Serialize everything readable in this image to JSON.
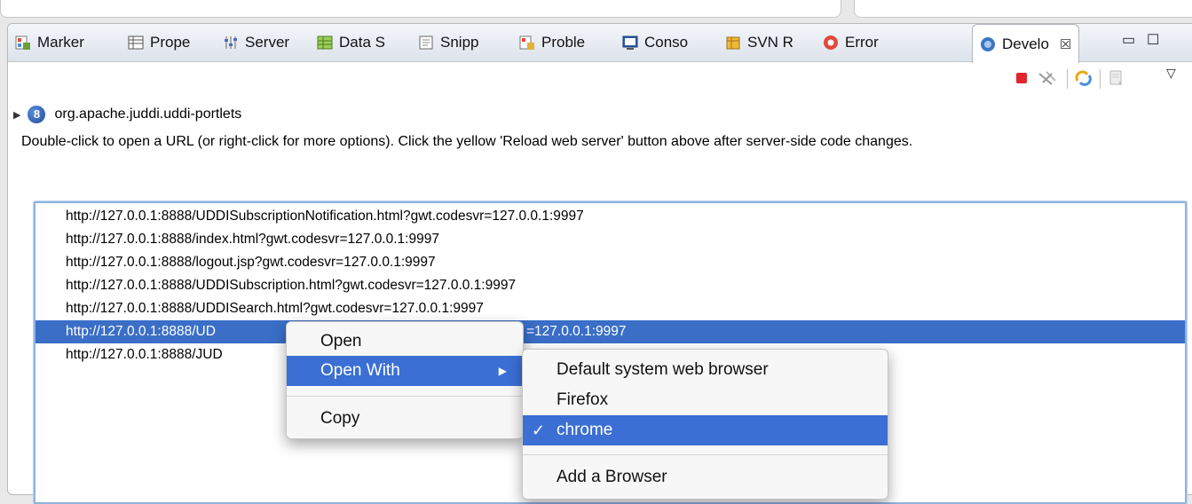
{
  "tabs": [
    {
      "label": "Marker",
      "icon": "marker-icon"
    },
    {
      "label": "Prope",
      "icon": "properties-icon"
    },
    {
      "label": "Server",
      "icon": "server-icon"
    },
    {
      "label": "Data S",
      "icon": "data-source-icon"
    },
    {
      "label": "Snipp",
      "icon": "snippets-icon"
    },
    {
      "label": "Proble",
      "icon": "problems-icon"
    },
    {
      "label": "Conso",
      "icon": "console-icon"
    },
    {
      "label": "SVN R",
      "icon": "svn-icon"
    },
    {
      "label": "Error",
      "icon": "error-icon"
    },
    {
      "label": "Develo",
      "icon": "gwt-icon",
      "close": "☒"
    }
  ],
  "window_buttons": {
    "minimize": "▭",
    "maximize": "☐",
    "view_menu": "▽"
  },
  "tree": {
    "project": "org.apache.juddi.uddi-portlets",
    "project_icon": "8"
  },
  "info_text": "Double-click to open a URL (or right-click for more options). Click the yellow 'Reload web server' button above after server-side code changes.",
  "urls": [
    "http://127.0.0.1:8888/UDDISubscriptionNotification.html?gwt.codesvr=127.0.0.1:9997",
    "http://127.0.0.1:8888/index.html?gwt.codesvr=127.0.0.1:9997",
    "http://127.0.0.1:8888/logout.jsp?gwt.codesvr=127.0.0.1:9997",
    "http://127.0.0.1:8888/UDDISubscription.html?gwt.codesvr=127.0.0.1:9997",
    "http://127.0.0.1:8888/UDDISearch.html?gwt.codesvr=127.0.0.1:9997",
    "http://127.0.0.1:8888/UD",
    "http://127.0.0.1:8888/JUD"
  ],
  "selected_url_tail": "=127.0.0.1:9997",
  "context_menu": {
    "open": "Open",
    "open_with": "Open With",
    "submenu_arrow": "▶",
    "copy": "Copy"
  },
  "submenu": {
    "default_browser": "Default system web browser",
    "firefox": "Firefox",
    "chrome": "chrome",
    "check": "✓",
    "add_browser": "Add a Browser"
  },
  "colors": {
    "selection": "#3a6ec7",
    "menu_highlight": "#3b6fd4"
  }
}
